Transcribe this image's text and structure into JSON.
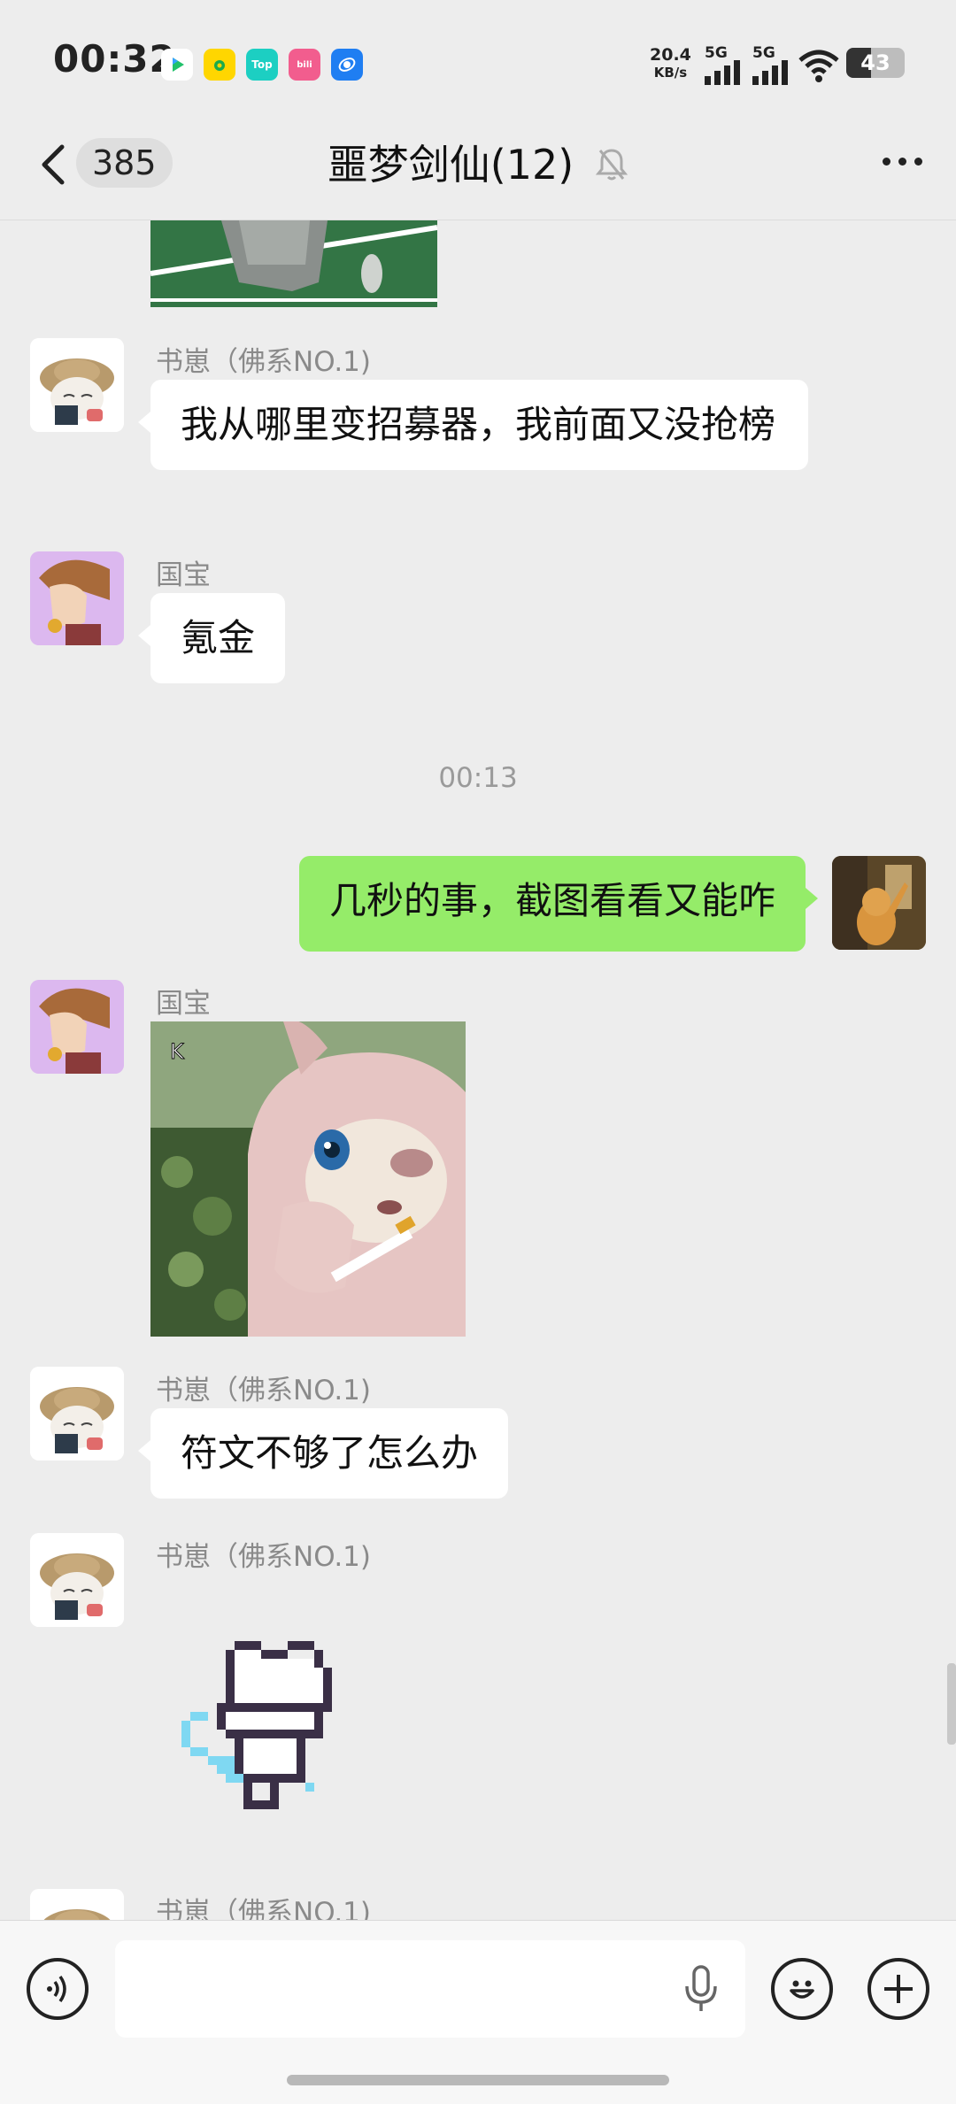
{
  "status_bar": {
    "time": "00:32",
    "net_speed_value": "20.4",
    "net_speed_unit": "KB/s",
    "signal_1": "5G",
    "signal_2": "5G",
    "battery": "43",
    "battery_level": 0.43,
    "app_icons": [
      "video-app-icon",
      "music-app-icon",
      "top-app-icon",
      "bilibili-icon",
      "browser-app-icon"
    ],
    "app_icon_top_label": "Top",
    "app_icon_bili_label": "bili"
  },
  "header": {
    "back_count": "385",
    "title": "噩梦剑仙(12)",
    "mute_icon": "bell-off-icon",
    "more_icon": "more-icon"
  },
  "messages": [
    {
      "type": "image",
      "from": "other",
      "content": "image-preview"
    },
    {
      "sender": "书崽（佛系NO.1)",
      "type": "text",
      "text": "我从哪里变招募器，我前面又没抢榜"
    },
    {
      "sender": "国宝",
      "type": "text",
      "text": "氪金"
    },
    {
      "type": "time",
      "text": "00:13"
    },
    {
      "from": "me",
      "type": "text",
      "text": "几秒的事，截图看看又能咋"
    },
    {
      "sender": "国宝",
      "type": "image",
      "content": "plush-bear-with-cigarette"
    },
    {
      "sender": "书崽（佛系NO.1)",
      "type": "text",
      "text": "符文不够了怎么办"
    },
    {
      "sender": "书崽（佛系NO.1)",
      "type": "sticker",
      "content": "pixel-cat-sticker"
    },
    {
      "sender": "书崽（佛系NO.1)",
      "type": "partial"
    }
  ],
  "bottom_bar": {
    "voice_icon": "voice-icon",
    "mic_icon": "mic-icon",
    "emoji_icon": "emoji-icon",
    "plus_icon": "plus-icon"
  },
  "colors": {
    "background": "#ededed",
    "my_bubble": "#95ec69",
    "other_bubble": "#ffffff"
  }
}
